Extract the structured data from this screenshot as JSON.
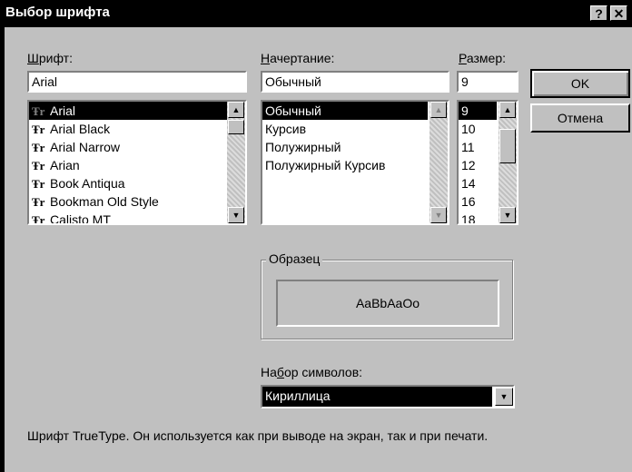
{
  "window": {
    "title": "Выбор шрифта",
    "help_label": "?",
    "close_label": "✕"
  },
  "font": {
    "label": "Шрифт:",
    "value": "Arial",
    "items": [
      "Arial",
      "Arial Black",
      "Arial Narrow",
      "Arian",
      "Book Antiqua",
      "Bookman Old Style",
      "Calisto MT"
    ],
    "icon": "truetype-icon",
    "icon_glyph": "Ŧr"
  },
  "style": {
    "label": "Начертание:",
    "value": "Обычный",
    "items": [
      "Обычный",
      "Курсив",
      "Полужирный",
      "Полужирный Курсив"
    ]
  },
  "size": {
    "label": "Размер:",
    "value": "9",
    "items": [
      "9",
      "10",
      "11",
      "12",
      "14",
      "16",
      "18"
    ]
  },
  "buttons": {
    "ok": "OK",
    "cancel": "Отмена"
  },
  "sample": {
    "label": "Образец",
    "text": "AaBbAaOo"
  },
  "charset": {
    "label": "Набор символов:",
    "value": "Кириллица"
  },
  "description": "Шрифт TrueType. Он используется как при выводе на экран, так и при печати."
}
